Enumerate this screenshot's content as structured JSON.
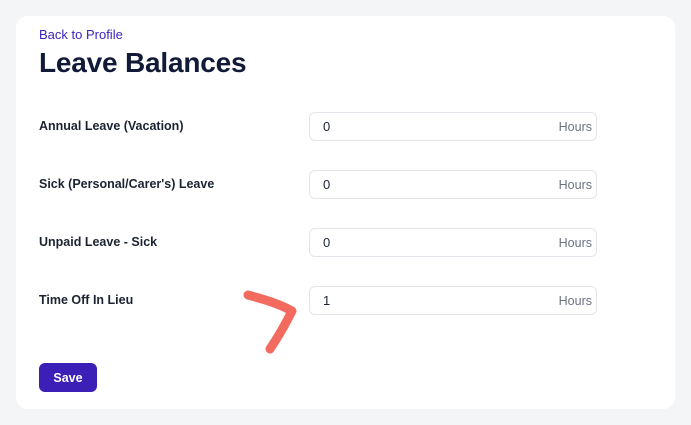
{
  "nav": {
    "back_label": "Back to Profile"
  },
  "page": {
    "title": "Leave Balances"
  },
  "leave_rows": [
    {
      "label": "Annual Leave (Vacation)",
      "value": "0",
      "unit": "Hours"
    },
    {
      "label": "Sick (Personal/Carer's) Leave",
      "value": "0",
      "unit": "Hours"
    },
    {
      "label": "Unpaid Leave - Sick",
      "value": "0",
      "unit": "Hours"
    },
    {
      "label": "Time Off In Lieu",
      "value": "1",
      "unit": "Hours"
    }
  ],
  "actions": {
    "save_label": "Save"
  },
  "colors": {
    "accent": "#3b1fb6",
    "link": "#3b24b8",
    "annotation": "#f26b5e"
  },
  "annotation": {
    "icon": "chevron-right-icon"
  }
}
